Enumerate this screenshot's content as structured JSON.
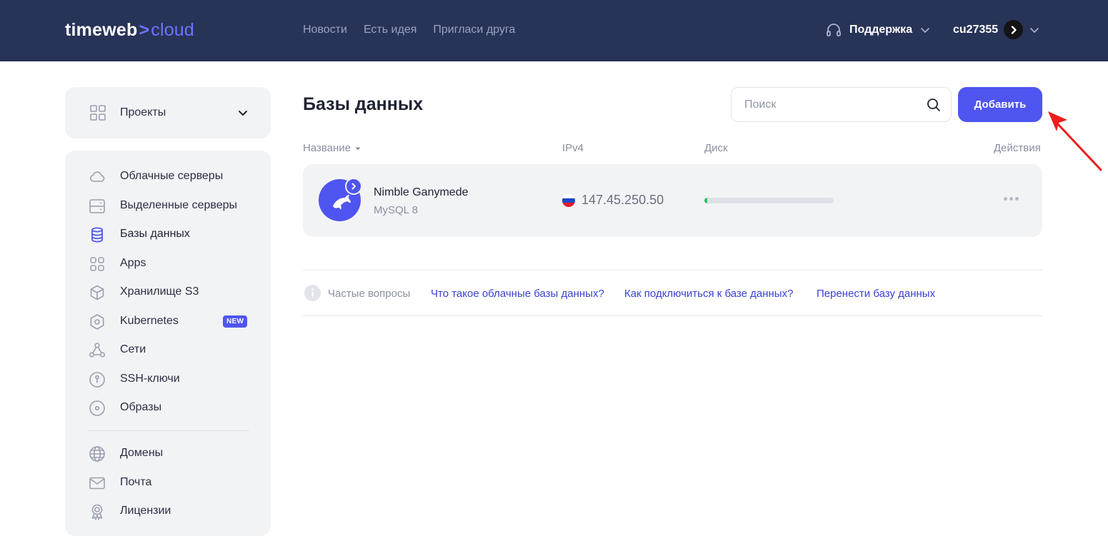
{
  "header": {
    "logo_main": "timeweb",
    "logo_chevron": ">",
    "logo_cloud": "cloud",
    "nav": [
      "Новости",
      "Есть идея",
      "Пригласи друга"
    ],
    "support_label": "Поддержка",
    "user_label": "cu27355"
  },
  "sidebar": {
    "projects_label": "Проекты",
    "items": [
      {
        "label": "Облачные серверы",
        "icon": "cloud-icon"
      },
      {
        "label": "Выделенные серверы",
        "icon": "server-icon"
      },
      {
        "label": "Базы данных",
        "icon": "database-icon",
        "active": true
      },
      {
        "label": "Apps",
        "icon": "apps-icon"
      },
      {
        "label": "Хранилище S3",
        "icon": "cube-icon"
      },
      {
        "label": "Kubernetes",
        "icon": "kubernetes-icon",
        "badge": "NEW"
      },
      {
        "label": "Сети",
        "icon": "network-icon"
      },
      {
        "label": "SSH-ключи",
        "icon": "key-icon"
      },
      {
        "label": "Образы",
        "icon": "disc-icon"
      },
      {
        "label": "Домены",
        "icon": "globe-icon"
      },
      {
        "label": "Почта",
        "icon": "mail-icon"
      },
      {
        "label": "Лицензии",
        "icon": "license-icon"
      }
    ]
  },
  "main": {
    "title": "Базы данных",
    "search_placeholder": "Поиск",
    "add_label": "Добавить",
    "columns": {
      "name": "Название",
      "ip": "IPv4",
      "disk": "Диск",
      "actions": "Действия"
    },
    "databases": [
      {
        "name": "Nimble Ganymede",
        "engine": "MySQL 8",
        "ip": "147.45.250.50",
        "disk_usage_fraction": 0.02
      }
    ],
    "faq": {
      "label": "Частые вопросы",
      "links": [
        "Что такое облачные базы данных?",
        "Как подключиться к базе данных?",
        "Перенести базу данных"
      ]
    }
  },
  "colors": {
    "header_bg": "#283358",
    "accent": "#4f55f0",
    "panel_bg": "#f2f3f5",
    "disk_fill": "#27c46a",
    "annotation_arrow": "#ee1c1c"
  }
}
